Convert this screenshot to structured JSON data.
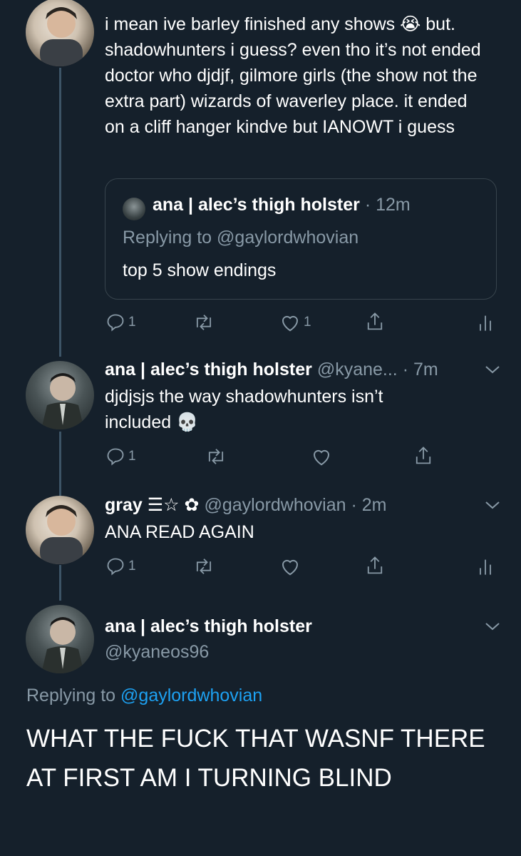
{
  "colors": {
    "background": "#15202b",
    "text": "#ffffff",
    "muted": "#8899a6",
    "link": "#1da1f2",
    "border": "#38444d"
  },
  "tweet1": {
    "text": "i mean ive barley finished any shows 😭 but. shadowhunters i guess? even tho it’s not ended doctor who djdjf, gilmore girls (the show not the extra part) wizards of waverley place. it ended on a cliff hanger kindve but IANOWT i guess",
    "quote": {
      "name": "ana | alec’s thigh holster",
      "time": "12m",
      "replying_prefix": "Replying to",
      "replying_handle": "@gaylordwhovian",
      "text": "top 5 show endings"
    },
    "actions": {
      "reply_count": "1",
      "like_count": "1"
    }
  },
  "tweet2": {
    "name": "ana | alec’s thigh holster",
    "handle": "@kyane...",
    "time": "7m",
    "text": "djdjsjs the way shadowhunters isn’t included 💀",
    "actions": {
      "reply_count": "1"
    }
  },
  "tweet3": {
    "name": "gray ☰☆ ✿",
    "handle": "@gaylordwhovian",
    "time": "2m",
    "text": "ANA READ AGAIN",
    "actions": {
      "reply_count": "1"
    }
  },
  "main_tweet": {
    "name": "ana | alec’s thigh holster",
    "handle": "@kyaneos96",
    "replying_prefix": "Replying to",
    "replying_handle": "@gaylordwhovian",
    "text": "WHAT THE FUCK THAT WASNF THERE AT FIRST AM I TURNING BLIND"
  }
}
